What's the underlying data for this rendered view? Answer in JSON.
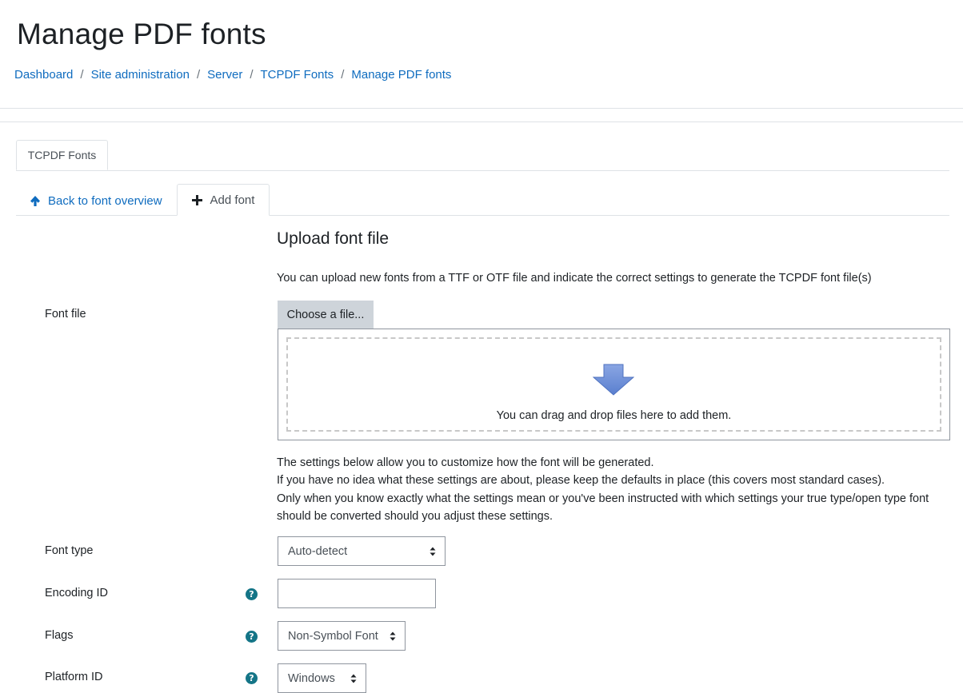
{
  "header": {
    "title": "Manage PDF fonts",
    "breadcrumb": [
      "Dashboard",
      "Site administration",
      "Server",
      "TCPDF Fonts",
      "Manage PDF fonts"
    ],
    "separator": "/"
  },
  "tabs": {
    "main": "TCPDF Fonts",
    "back": "Back to font overview",
    "add": "Add font"
  },
  "form": {
    "heading": "Upload font file",
    "intro": "You can upload new fonts from a TTF or OTF file and indicate the correct settings to generate the TCPDF font file(s)",
    "font_file_label": "Font file",
    "choose_button": "Choose a file...",
    "drop_text": "You can drag and drop files here to add them.",
    "notes": [
      "The settings below allow you to customize how the font will be generated.",
      "If you have no idea what these settings are about, please keep the defaults in place (this covers most standard cases).",
      "Only when you know exactly what the settings mean or you've been instructed with which settings your true type/open type font should be converted should you adjust these settings."
    ],
    "font_type": {
      "label": "Font type",
      "value": "Auto-detect"
    },
    "encoding_id": {
      "label": "Encoding ID",
      "value": ""
    },
    "flags": {
      "label": "Flags",
      "value": "Non-Symbol Font"
    },
    "platform_id": {
      "label": "Platform ID",
      "value": "Windows"
    },
    "help_glyph": "?"
  },
  "colors": {
    "link": "#0f6cbf",
    "help": "#147587",
    "button_bg": "#ced4da",
    "drop_arrow": "#6f8fd6"
  }
}
